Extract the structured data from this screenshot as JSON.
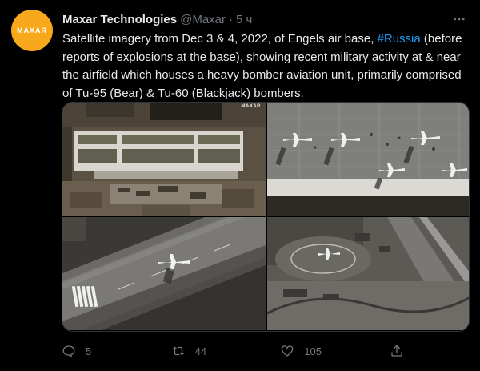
{
  "author": {
    "avatar_text": "MAXAR",
    "name": "Maxar Technologies",
    "handle": "@Maxar",
    "separator": "·",
    "time": "5 ч"
  },
  "tweet": {
    "text_before_hashtag": "Satellite imagery from Dec 3 & 4, 2022, of Engels air base, ",
    "hashtag": "#Russia",
    "text_after_hashtag": " (before reports of explosions at the base), showing recent military activity at & near the airfield which houses a heavy bomber aviation unit, primarily comprised of Tu-95 (Bear) & Tu-60 (Blackjack) bombers."
  },
  "media": {
    "watermark": "MAXAR",
    "images": [
      {
        "icon": "satellite-airbase-overview-image"
      },
      {
        "icon": "satellite-bombers-apron-image"
      },
      {
        "icon": "satellite-runway-bomber-image"
      },
      {
        "icon": "satellite-revetment-bomber-image"
      }
    ]
  },
  "actions": {
    "reply_count": "5",
    "retweet_count": "44",
    "like_count": "105"
  },
  "colors": {
    "background": "#000000",
    "text": "#e7e9ea",
    "muted": "#71767b",
    "link": "#1d9bf0",
    "avatar": "#f7a81b"
  }
}
